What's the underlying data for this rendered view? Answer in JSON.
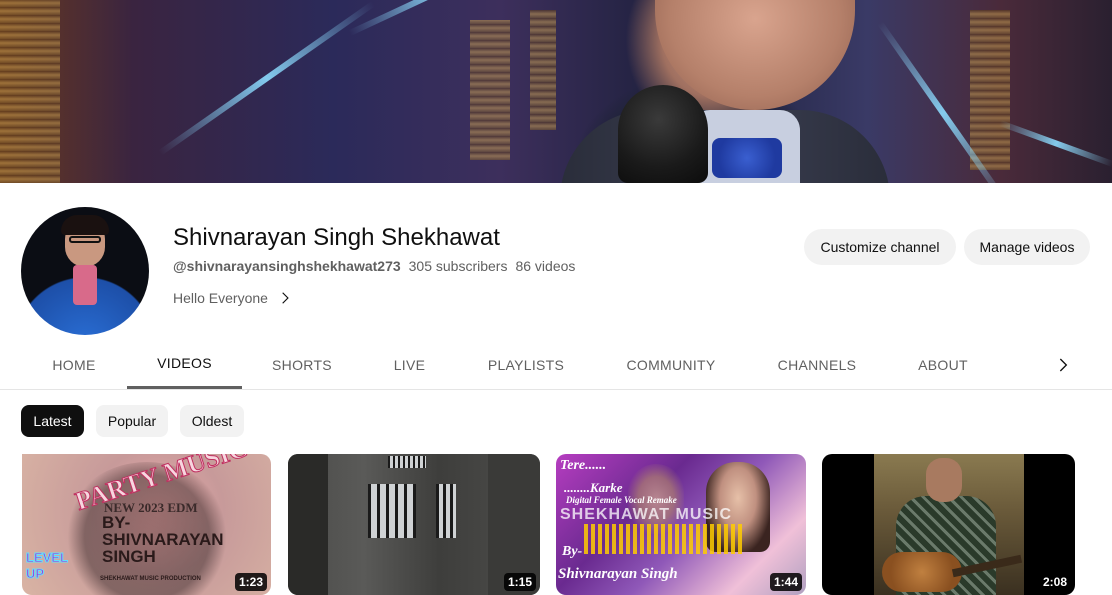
{
  "channel": {
    "name": "Shivnarayan Singh Shekhawat",
    "handle": "@shivnarayansinghshekhawat273",
    "subscribers": "305 subscribers",
    "videos_count": "86 videos",
    "description": "Hello Everyone"
  },
  "actions": {
    "customize_label": "Customize channel",
    "manage_label": "Manage videos"
  },
  "tabs": [
    {
      "label": "HOME",
      "active": false
    },
    {
      "label": "VIDEOS",
      "active": true
    },
    {
      "label": "SHORTS",
      "active": false
    },
    {
      "label": "LIVE",
      "active": false
    },
    {
      "label": "PLAYLISTS",
      "active": false
    },
    {
      "label": "COMMUNITY",
      "active": false
    },
    {
      "label": "CHANNELS",
      "active": false
    },
    {
      "label": "ABOUT",
      "active": false
    }
  ],
  "tab_next_icon": "chevron-right-icon",
  "filters": [
    {
      "label": "Latest",
      "active": true
    },
    {
      "label": "Popular",
      "active": false
    },
    {
      "label": "Oldest",
      "active": false
    }
  ],
  "videos": [
    {
      "duration": "1:23",
      "thumb_text": {
        "party": "PARTY MUSIC",
        "new": "NEW 2023 EDM",
        "by": "BY- SHIVNARAYAN SINGH",
        "production": "SHEKHAWAT MUSIC PRODUCTION",
        "level": "LEVEL UP"
      }
    },
    {
      "duration": "1:15"
    },
    {
      "duration": "1:44",
      "thumb_text": {
        "tere": "Tere......",
        "karke": "........Karke",
        "digital": "Digital Female Vocal Remake",
        "brand": "SHEKHAWAT MUSIC",
        "by": "By-",
        "name": "Shivnarayan Singh"
      }
    },
    {
      "duration": "2:08"
    }
  ],
  "colors": {
    "text_primary": "#0f0f0f",
    "text_secondary": "#606060",
    "chip_bg": "#f2f2f2",
    "chip_active_bg": "#0f0f0f"
  }
}
